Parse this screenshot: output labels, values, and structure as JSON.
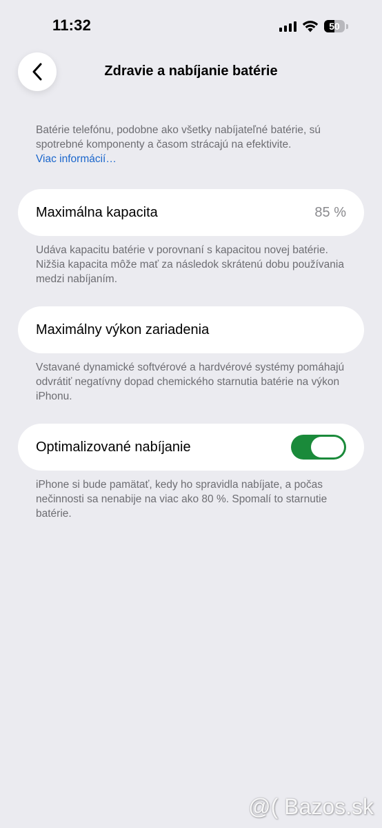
{
  "status_bar": {
    "time": "11:32",
    "battery_level": "50",
    "battery_fraction": 0.5,
    "icons": [
      "cellular-signal-icon",
      "wifi-icon",
      "battery-icon"
    ]
  },
  "nav": {
    "back_icon": "chevron-left-icon",
    "title": "Zdravie a nabíjanie batérie"
  },
  "intro": {
    "text": "Batérie telefónu, podobne ako všetky nabíjateľné batérie, sú spotrebné komponenty a časom strácajú na efektivite.",
    "link": "Viac informácií…"
  },
  "max_capacity": {
    "label": "Maximálna kapacita",
    "value": "85 %",
    "footer": "Udáva kapacitu batérie v porovnaní s kapacitou novej batérie. Nižšia kapacita môže mať za následok skrátenú dobu používania medzi nabíjaním."
  },
  "peak_performance": {
    "label": "Maximálny výkon zariadenia",
    "footer": "Vstavané dynamické softvérové a hardvérové systémy pomáhajú odvrátiť negatívny dopad chemického starnutia batérie na výkon iPhonu."
  },
  "optimized_charging": {
    "label": "Optimalizované nabíjanie",
    "enabled": true,
    "footer": "iPhone si bude pamätať, kedy ho spravidla nabíjate, a počas nečinnosti sa nenabije na viac ako 80 %. Spomalí to starnutie batérie."
  },
  "colors": {
    "background": "#ebebf0",
    "link": "#1a66cc",
    "toggle_on": "#1a8a3a",
    "secondary_text": "#6d6d72"
  },
  "watermark": "@( Bazos.sk"
}
